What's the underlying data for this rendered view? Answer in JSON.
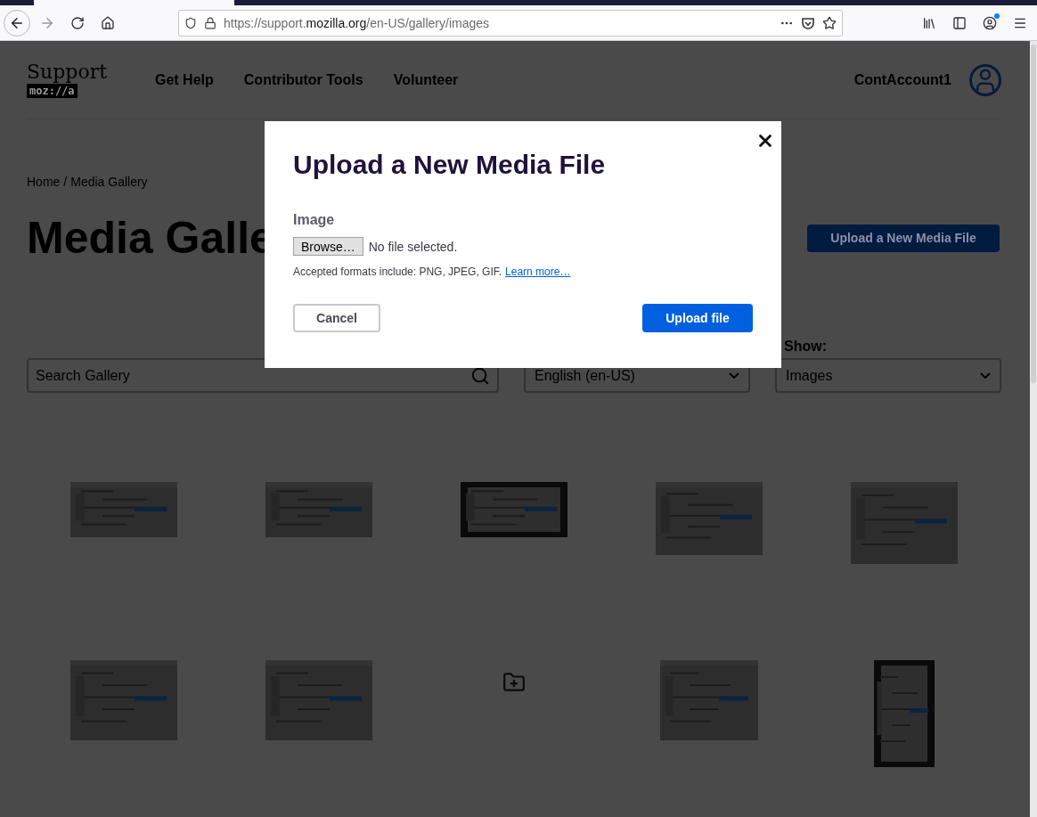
{
  "browser": {
    "url": {
      "scheme_host": "https://support.",
      "domain": "mozilla.org",
      "path": "/en-US/gallery/images"
    },
    "account_notification": true
  },
  "header": {
    "logo": {
      "title": "Support",
      "badge": "moz://a"
    },
    "nav": [
      {
        "label": "Get Help"
      },
      {
        "label": "Contributor Tools"
      },
      {
        "label": "Volunteer"
      }
    ],
    "account": "ContAccount1"
  },
  "breadcrumb": {
    "items": [
      {
        "label": "Home"
      },
      {
        "label": "Media Gallery"
      }
    ],
    "separator": "/"
  },
  "page": {
    "title": "Media Galle",
    "upload_button": "Upload a New Media File"
  },
  "filters": {
    "search": {
      "placeholder": "Search Gallery"
    },
    "language": {
      "value": "English (en-US)"
    },
    "show": {
      "label": "Show:",
      "value": "Images"
    }
  },
  "gallery": [
    {
      "kind": "picture"
    },
    {
      "kind": "picture"
    },
    {
      "kind": "picture"
    },
    {
      "kind": "picture"
    },
    {
      "kind": "picture"
    },
    {
      "kind": "picture"
    },
    {
      "kind": "picture"
    },
    {
      "kind": "folder"
    },
    {
      "kind": "picture"
    },
    {
      "kind": "picture"
    }
  ],
  "dialog": {
    "title": "Upload a New Media File",
    "field_label": "Image",
    "browse_button": "Browse…",
    "file_status": "No file selected.",
    "help": "Accepted formats include: PNG, JPEG, GIF.",
    "help_link": "Learn more…",
    "cancel": "Cancel",
    "submit": "Upload file"
  }
}
